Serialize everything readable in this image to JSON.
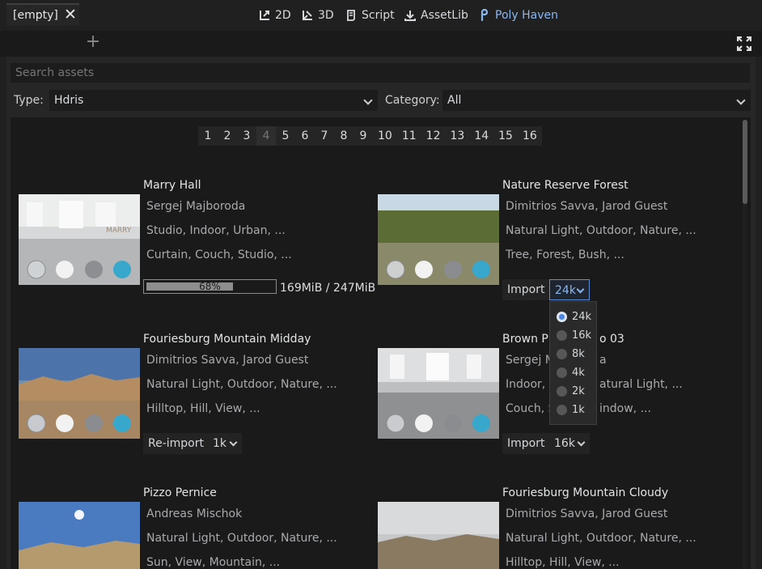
{
  "toolbar": {
    "items": [
      {
        "label": "2D",
        "icon": "2d-transform-icon"
      },
      {
        "label": "3D",
        "icon": "3d-transform-icon"
      },
      {
        "label": "Script",
        "icon": "script-icon"
      },
      {
        "label": "AssetLib",
        "icon": "download-icon"
      },
      {
        "label": "Poly Haven",
        "icon": "polyhaven-icon",
        "active": true
      }
    ]
  },
  "tabs": [
    {
      "label": "[empty]"
    }
  ],
  "search": {
    "placeholder": "Search assets"
  },
  "filters": {
    "type_label": "Type:",
    "type_value": "Hdris",
    "category_label": "Category:",
    "category_value": "All"
  },
  "pagination": {
    "pages": [
      "1",
      "2",
      "3",
      "4",
      "5",
      "6",
      "7",
      "8",
      "9",
      "10",
      "11",
      "12",
      "13",
      "14",
      "15",
      "16"
    ],
    "current": "4"
  },
  "assets": [
    {
      "title": "Marry Hall",
      "authors": "Sergej Majboroda",
      "categories": "Studio, Indoor, Urban, ...",
      "tags": "Curtain, Couch, Studio, ...",
      "progress_percent": 68,
      "progress_label": "68%",
      "progress_text": "169MiB / 247MiB"
    },
    {
      "title": "Nature Reserve Forest",
      "authors": "Dimitrios Savva, Jarod Guest",
      "categories": "Natural Light, Outdoor, Nature, ...",
      "tags": "Tree, Forest, Bush, ...",
      "button": "Import",
      "resolution": "24k"
    },
    {
      "title": "Fouriesburg Mountain Midday",
      "authors": "Dimitrios Savva, Jarod Guest",
      "categories": "Natural Light, Outdoor, Nature, ...",
      "tags": "Hilltop, Hill, View, ...",
      "button": "Re-import",
      "resolution": "1k"
    },
    {
      "title": "Brown Ph",
      "title_tail": "o 03",
      "authors": "Sergej M",
      "authors_tail": "a",
      "categories": "Indoor,",
      "categories_tail": "atural Light, ...",
      "tags": "Couch, S",
      "tags_tail": "indow, ...",
      "button": "Import",
      "resolution": "16k"
    },
    {
      "title": "Pizzo Pernice",
      "authors": "Andreas Mischok",
      "categories": "Natural Light, Outdoor, Nature, ...",
      "tags": "Sun, View, Mountain, ..."
    },
    {
      "title": "Fouriesburg Mountain Cloudy",
      "authors": "Dimitrios Savva, Jarod Guest",
      "categories": "Natural Light, Outdoor, Nature, ...",
      "tags": "Hilltop, Hill, View, ..."
    }
  ],
  "resolution_menu": {
    "options": [
      "24k",
      "16k",
      "8k",
      "4k",
      "2k",
      "1k"
    ],
    "selected": "24k"
  },
  "colors": {
    "accent": "#8ab7f0",
    "background": "#202020",
    "panel": "#262626"
  }
}
